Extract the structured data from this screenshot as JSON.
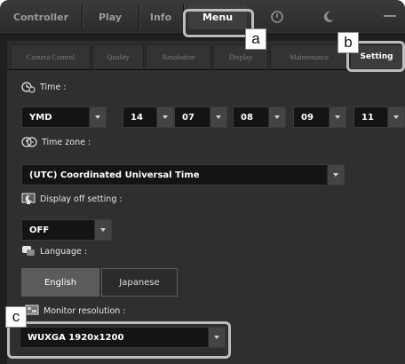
{
  "top_tabs": [
    "Controller",
    "Play",
    "Info",
    "Menu"
  ],
  "top_icons": [
    "power-icon",
    "moon-icon",
    "minimize-icon"
  ],
  "sub_tabs": [
    "Camera Control",
    "Quality",
    "Resolution",
    "Display",
    "Maintenance",
    "Setting"
  ],
  "time": {
    "label": "Time :",
    "values": [
      "YMD",
      "14",
      "07",
      "08",
      "09",
      "11"
    ]
  },
  "timezone": {
    "label": "Time zone :",
    "value": "(UTC) Coordinated Universal Time"
  },
  "display_off": {
    "label": "Display off setting :",
    "value": "OFF"
  },
  "language": {
    "label": "Language :",
    "options": [
      "English",
      "Japanese"
    ],
    "selected": "English"
  },
  "monitor": {
    "label": "Monitor resolution :",
    "value": "WUXGA 1920x1200"
  },
  "callouts": {
    "a": "a",
    "b": "b",
    "c": "c"
  },
  "colors": {
    "highlight": "#bdbdbd",
    "background": "#2f2f2f"
  }
}
